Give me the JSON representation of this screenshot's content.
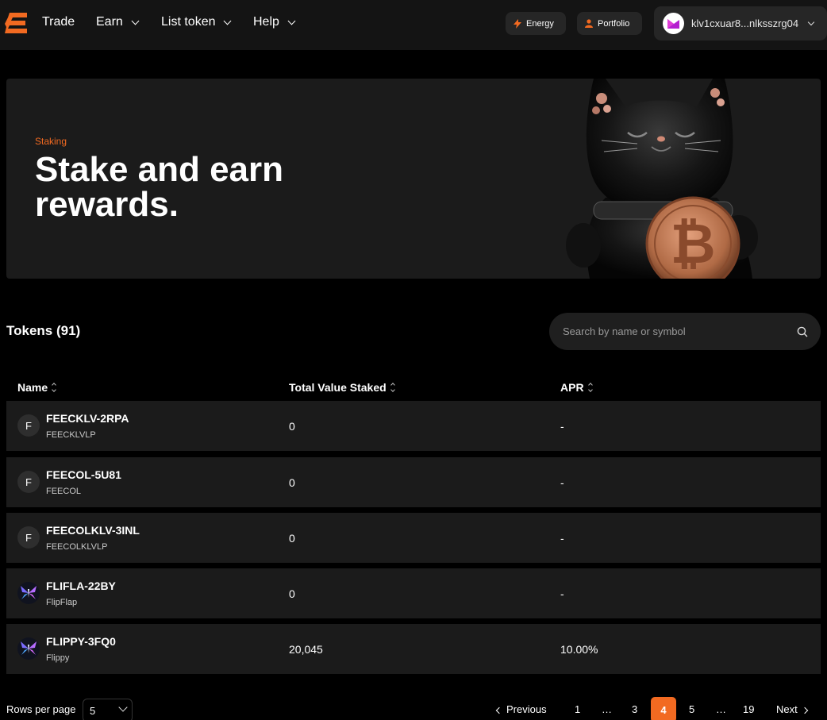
{
  "nav": {
    "links": [
      "Trade",
      "Earn",
      "List token",
      "Help"
    ],
    "energy_label": "Energy",
    "portfolio_label": "Portfolio",
    "wallet_address": "klv1cxuar8...nlksszrg04",
    "accent": "#f26a21"
  },
  "hero": {
    "eyebrow": "Staking",
    "title": "Stake and earn rewards."
  },
  "tokens": {
    "title": "Tokens (91)",
    "search_placeholder": "Search by name or symbol"
  },
  "table": {
    "headers": [
      "Name",
      "Total Value Staked",
      "APR"
    ],
    "rows": [
      {
        "icon": "F",
        "name": "FEECKLV-2RPA",
        "sub": "FEECKLVLP",
        "tvs": "0",
        "apr": "-"
      },
      {
        "icon": "F",
        "name": "FEECOL-5U81",
        "sub": "FEECOL",
        "tvs": "0",
        "apr": "-"
      },
      {
        "icon": "F",
        "name": "FEECOLKLV-3INL",
        "sub": "FEECOLKLVLP",
        "tvs": "0",
        "apr": "-"
      },
      {
        "icon": "butterfly-icon",
        "name": "FLIFLA-22BY",
        "sub": "FlipFlap",
        "tvs": "0",
        "apr": "-"
      },
      {
        "icon": "butterfly-icon",
        "name": "FLIPPY-3FQ0",
        "sub": "Flippy",
        "tvs": "20,045",
        "apr": "10.00%"
      }
    ]
  },
  "pagination": {
    "rows_per_page_label": "Rows per page",
    "rows_per_page_value": "5",
    "previous_label": "Previous",
    "next_label": "Next",
    "pages": [
      "1",
      "…",
      "3",
      "4",
      "5",
      "…",
      "19"
    ],
    "current_page": "4"
  }
}
